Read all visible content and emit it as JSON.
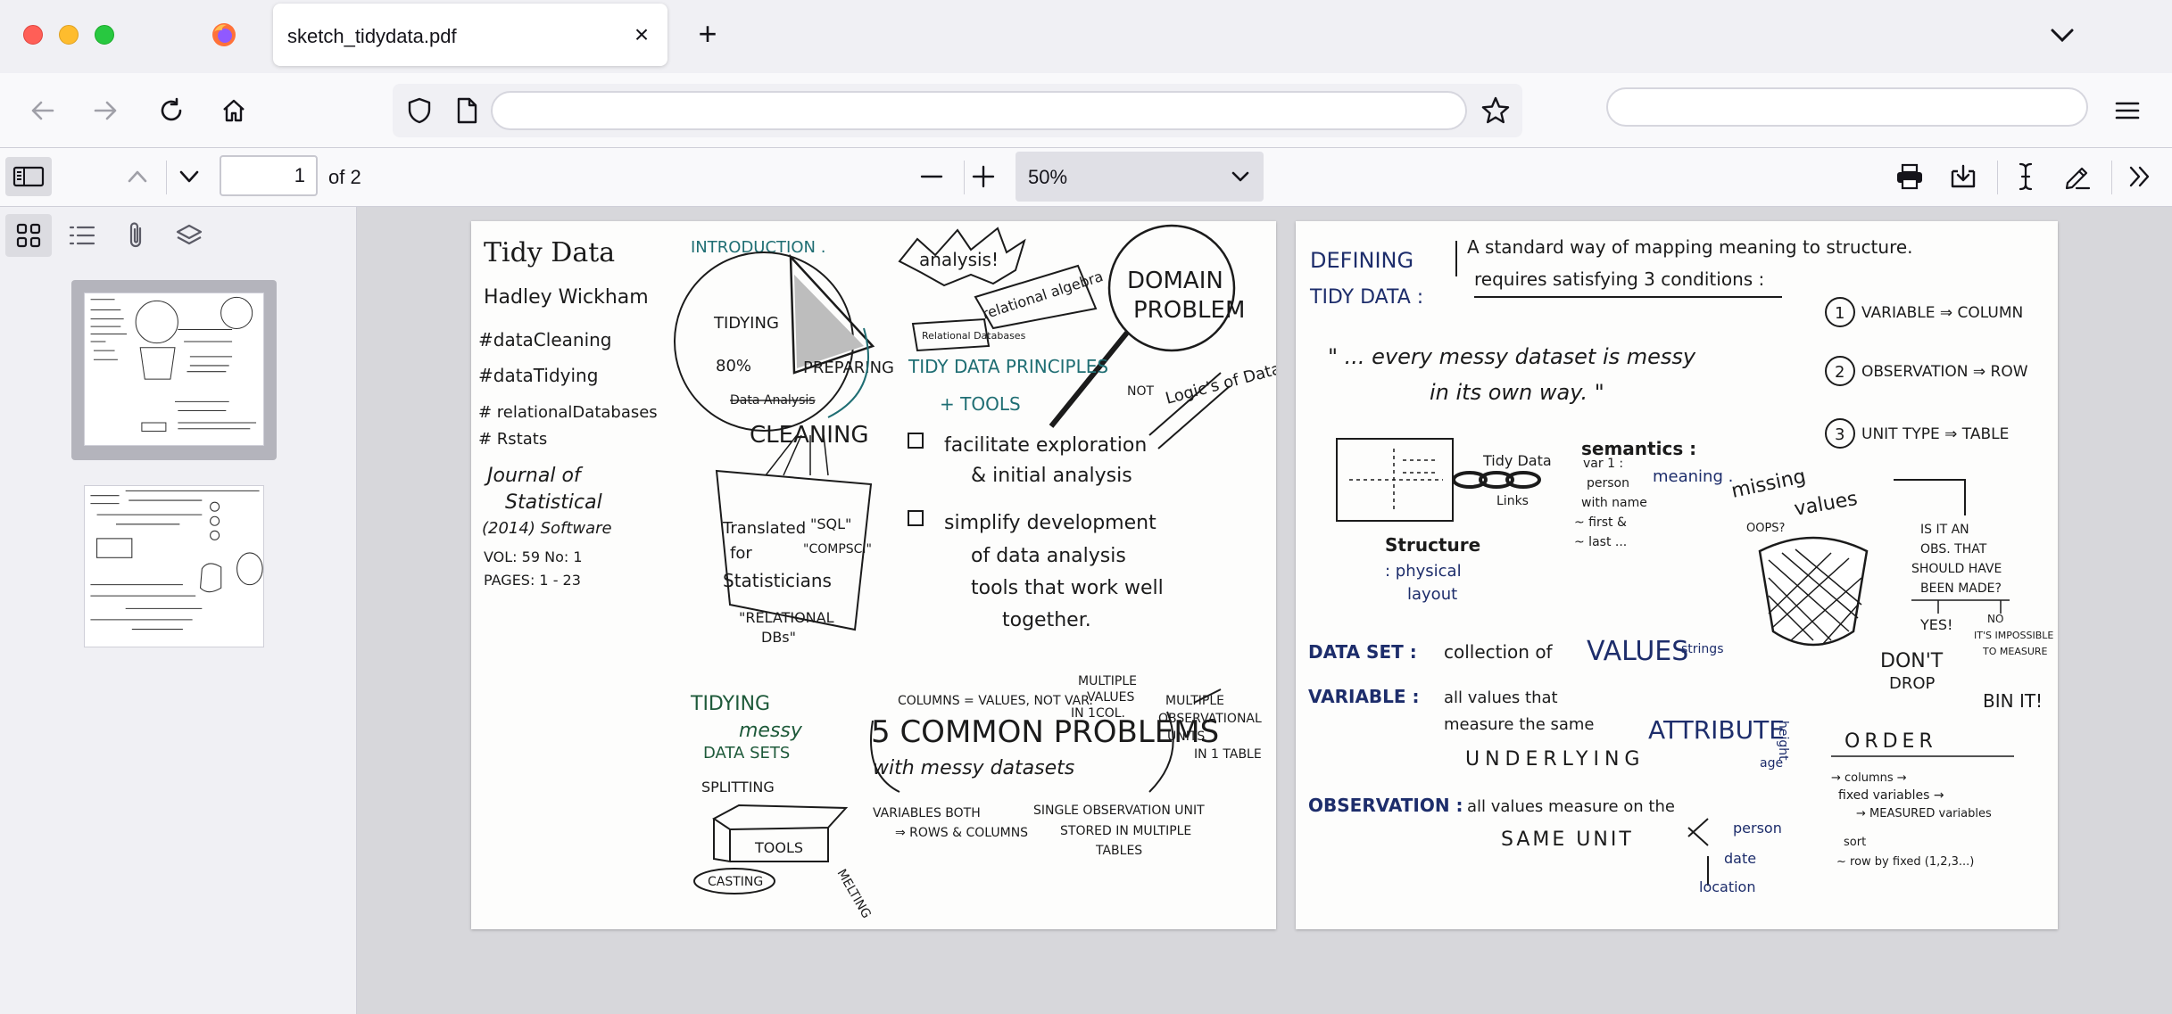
{
  "window": {
    "tab_title": "sketch_tidydata.pdf"
  },
  "navbar": {
    "url_value": "",
    "search_value": ""
  },
  "pdf_toolbar": {
    "page_number": "1",
    "page_count": "of 2",
    "zoom": "50%"
  },
  "colors": {
    "ink": "#1b1b1b",
    "teal": "#1f6e73",
    "blue_ink": "#1d2d6b",
    "green_ink": "#1e5a3a"
  },
  "page1": {
    "title": "Tidy Data",
    "author": "Hadley Wickham",
    "tags": [
      "#dataCleaning",
      "#dataTidying",
      "# relationalDatabases",
      "# Rstats"
    ],
    "journal": [
      "Journal of",
      "Statistical",
      "(2014) Software"
    ],
    "vol": "VOL: 59   No: 1",
    "pages": "PAGES: 1 - 23",
    "intro": "INTRODUCTION .",
    "analysis": "analysis!",
    "relational_algebra": "relational algebra",
    "relational_databases": "Relational Databases",
    "domain_problem": [
      "DOMAIN",
      "PROBLEM"
    ],
    "tidying": "TIDYING",
    "percent": "80%",
    "preparing": "PREPARING",
    "data_analysis_struck": "Data Analysis",
    "cleaning": "CLEANING",
    "principles": "TIDY DATA PRINCIPLES",
    "tools": "+ TOOLS",
    "not": "NOT",
    "logic": "Logic's of Data.",
    "p1": [
      "facilitate exploration",
      "& initial analysis"
    ],
    "p2": [
      "simplify development",
      "of data analysis",
      "tools that work well",
      "together."
    ],
    "translated": [
      "Translated",
      "for",
      "Statisticians"
    ],
    "sql": "\"SQL\"",
    "compsci": "\"COMPSCI\"",
    "relational_dbs": [
      "\"RELATIONAL",
      "DBs\""
    ],
    "tidying_messy": [
      "TIDYING",
      "messy",
      "DATA SETS"
    ],
    "columns_values": "COLUMNS = VALUES, NOT VAR.",
    "multiple_values": [
      "MULTIPLE",
      "VALUES",
      "IN 1COL."
    ],
    "multiple_units": [
      "MULTIPLE",
      "OBSERVATIONAL",
      "UNITS",
      "IN 1 TABLE"
    ],
    "five_problems": "5 COMMON PROBLEMS",
    "with_messy": "with messy datasets",
    "splitting": "SPLITTING",
    "tools_box": "TOOLS",
    "casting": "CASTING",
    "melting": "MELTING",
    "vars_both": [
      "VARIABLES BOTH",
      "⇒ ROWS & COLUMNS"
    ],
    "single_obs": [
      "SINGLE OBSERVATION UNIT",
      "STORED IN MULTIPLE",
      "TABLES"
    ]
  },
  "page2": {
    "defining": [
      "DEFINING",
      "TIDY DATA :"
    ],
    "standard": [
      "A standard way of mapping meaning to structure.",
      "requires satisfying 3 conditions :"
    ],
    "conditions": [
      "VARIABLE ⇒ COLUMN",
      "OBSERVATION ⇒ ROW",
      "UNIT TYPE ⇒ TABLE"
    ],
    "quote": [
      "\" ... every messy dataset is messy",
      "in its own way. \""
    ],
    "tidy_links": [
      "Tidy Data",
      "Links"
    ],
    "semantics": "semantics :",
    "meaning": "meaning .",
    "var_notes": [
      "var 1 :",
      "person",
      "with name",
      "~ first &",
      "~ last ..."
    ],
    "structure": [
      "Structure",
      ": physical",
      "layout"
    ],
    "missing": [
      "missing",
      "values"
    ],
    "oops": "OOPS?",
    "obs_question": [
      "IS IT AN",
      "OBS. THAT",
      "SHOULD HAVE",
      "BEEN MADE?"
    ],
    "yes": "YES!",
    "no": [
      "NO",
      "IT'S IMPOSSIBLE",
      "TO MEASURE"
    ],
    "dont_drop": [
      "DON'T",
      "DROP"
    ],
    "bin_it": "BIN IT!",
    "dataset": [
      "DATA SET :",
      "collection of",
      "VALUES",
      "strings"
    ],
    "variable": [
      "VARIABLE :",
      "all values that",
      "measure the same",
      "ATTRIBUTE"
    ],
    "underlying": "UNDERLYING",
    "order": "ORDER",
    "order_notes": [
      "→ columns →",
      "fixed variables →",
      "→ MEASURED variables",
      "sort",
      "~ row by fixed (1,2,3...)"
    ],
    "observation": [
      "OBSERVATION :",
      "all values measure on the",
      "SAME UNIT"
    ],
    "unit_examples": [
      "person",
      "date",
      "location"
    ],
    "height": "height",
    "age": "age"
  }
}
